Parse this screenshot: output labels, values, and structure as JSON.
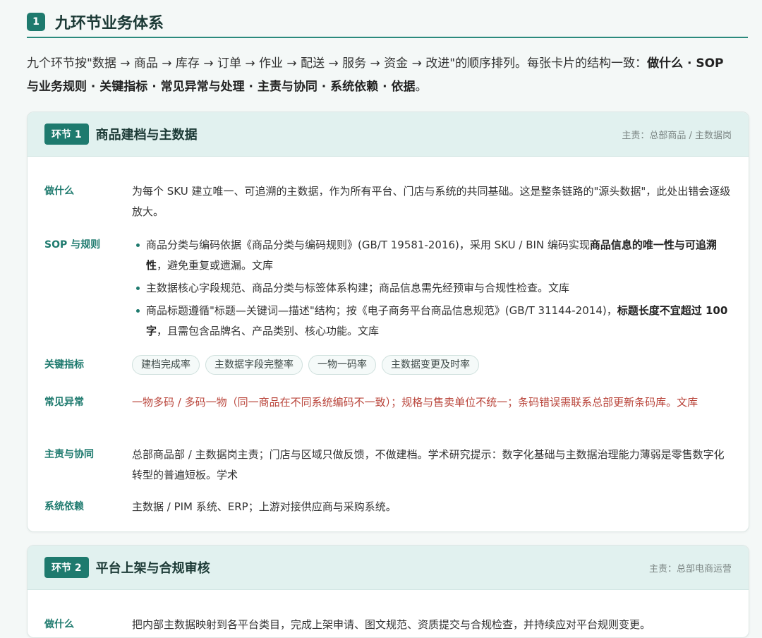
{
  "section": {
    "number": "1",
    "title": "九环节业务体系",
    "intro_prefix": "九个环节按\"数据 → 商品 → 库存 → 订单 → 作业 → 配送 → 服务 → 资金 → 改进\"的顺序排列。每张卡片的结构一致：",
    "intro_bold": "做什么 · SOP 与业务规则 · 关键指标 · 常见异常与处理 · 主责与协同 · 系统依赖 · 依据",
    "intro_suffix": "。"
  },
  "cards": [
    {
      "stage": "环节 1",
      "title": "商品建档与主数据",
      "owner": "主责：总部商品 / 主数据岗",
      "labels": {
        "what": "做什么",
        "sop": "SOP 与规则",
        "kpi": "关键指标",
        "exceptions": "常见异常",
        "owner": "主责与协同",
        "systems": "系统依赖"
      },
      "what": "为每个 SKU 建立唯一、可追溯的主数据，作为所有平台、门店与系统的共同基础。这是整条链路的\"源头数据\"，此处出错会逐级放大。",
      "sop": [
        {
          "pre": "商品分类与编码依据《商品分类与编码规则》(GB/T 19581-2016)，采用 SKU / BIN 编码实现",
          "bold": "商品信息的唯一性与可追溯性",
          "post": "，避免重复或遗漏。文库"
        },
        {
          "pre": "主数据核心字段规范、商品分类与标签体系构建；商品信息需先经预审与合规性检查。文库",
          "bold": "",
          "post": ""
        },
        {
          "pre": "商品标题遵循\"标题—关键词—描述\"结构；按《电子商务平台商品信息规范》(GB/T 31144-2014)，",
          "bold": "标题长度不宜超过 100 字",
          "post": "，且需包含品牌名、产品类别、核心功能。文库"
        }
      ],
      "kpis": [
        "建档完成率",
        "主数据字段完整率",
        "一物一码率",
        "主数据变更及时率"
      ],
      "exceptions": "一物多码 / 多码一物（同一商品在不同系统编码不一致）；规格与售卖单位不统一；条码错误需联系总部更新条码库。文库",
      "responsibility": "总部商品部 / 主数据岗主责；门店与区域只做反馈，不做建档。学术研究提示：数字化基础与主数据治理能力薄弱是零售数字化转型的普遍短板。学术",
      "systems": "主数据 / PIM 系统、ERP；上游对接供应商与采购系统。"
    },
    {
      "stage": "环节 2",
      "title": "平台上架与合规审核",
      "owner": "主责：总部电商运营",
      "labels": {
        "what": "做什么"
      },
      "what": "把内部主数据映射到各平台类目，完成上架申请、图文规范、资质提交与合规检查，并持续应对平台规则变更。"
    }
  ],
  "colors": {
    "accent": "#1e7a6e",
    "card_header_bg": "#e1f1ef",
    "danger_text": "#b9443a",
    "page_bg": "#f4f8f7"
  }
}
